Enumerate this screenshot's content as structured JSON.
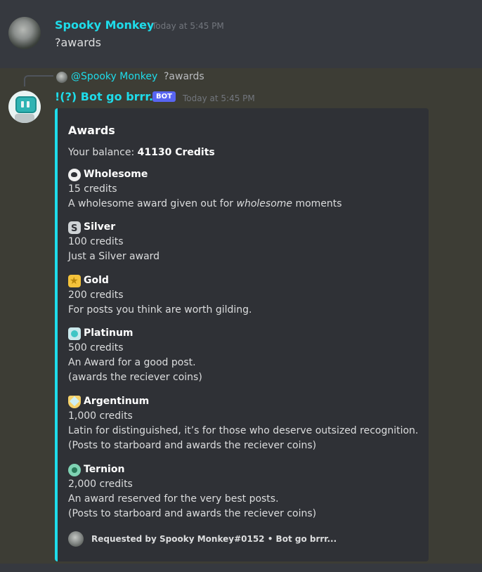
{
  "message1": {
    "author": "Spooky Monkey",
    "timestamp": "Today at 5:45 PM",
    "content": "?awards"
  },
  "message2": {
    "reply": {
      "author": "@Spooky Monkey",
      "content": "?awards"
    },
    "author": "!(?) Bot go brrr...",
    "bot_tag": "BOT",
    "timestamp": "Today at 5:45 PM",
    "embed": {
      "accent_color": "#1edcea",
      "title": "Awards",
      "balance_label": "Your balance: ",
      "balance_value": "41130 Credits",
      "awards": [
        {
          "icon": "wholesome-icon",
          "name": "Wholesome",
          "credits": "15 credits",
          "desc_pre": "A wholesome award given out for ",
          "desc_em": "wholesome",
          "desc_post": " moments"
        },
        {
          "icon": "silver-icon",
          "name": "Silver",
          "credits": "100 credits",
          "desc": "Just a Silver award"
        },
        {
          "icon": "gold-icon",
          "name": "Gold",
          "credits": "200 credits",
          "desc": "For posts you think are worth gilding."
        },
        {
          "icon": "platinum-icon",
          "name": "Platinum",
          "credits": "500 credits",
          "desc": "An Award for a good post.",
          "desc2": "(awards the reciever coins)"
        },
        {
          "icon": "argentinum-icon",
          "name": "Argentinum",
          "credits": "1,000 credits",
          "desc": "Latin for distinguished, it’s for those who deserve outsized recognition.",
          "desc2": "(Posts to starboard and awards the reciever coins)"
        },
        {
          "icon": "ternion-icon",
          "name": "Ternion",
          "credits": "2,000 credits",
          "desc": "An award reserved for the very best posts.",
          "desc2": "(Posts to starboard and awards the reciever coins)"
        }
      ],
      "footer": "Requested by Spooky Monkey#0152 • Bot go brrr..."
    }
  }
}
